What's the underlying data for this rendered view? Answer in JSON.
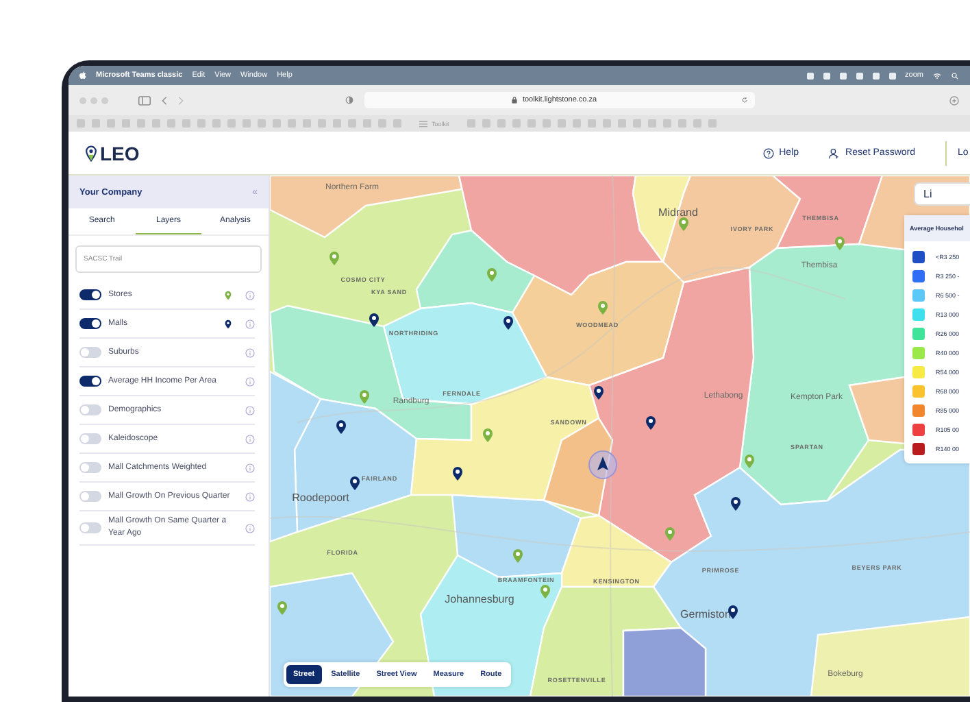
{
  "menu_bar": {
    "app_name": "Microsoft Teams classic",
    "menus": [
      "Edit",
      "View",
      "Window",
      "Help"
    ],
    "status_text": "zoom"
  },
  "browser": {
    "url": "toolkit.lightstone.co.za",
    "bookmark_folder": "Toolkit"
  },
  "header": {
    "logo": "LEO",
    "links": [
      "Help",
      "Reset Password"
    ],
    "cut_link": "Lo"
  },
  "sidebar": {
    "title": "Your Company",
    "collapse": "«",
    "tabs": [
      {
        "label": "Search",
        "selected": false
      },
      {
        "label": "Layers",
        "selected": true
      },
      {
        "label": "Analysis",
        "selected": false
      }
    ],
    "search": {
      "placeholder": "SACSC Trail"
    },
    "layers": [
      {
        "label": "Stores",
        "on": true,
        "color": "#7cb342"
      },
      {
        "label": "Malls",
        "on": true,
        "color": "#0d2a6b"
      },
      {
        "label": "Suburbs",
        "on": false
      },
      {
        "label": "Average HH Income Per Area",
        "on": true
      },
      {
        "label": "Demographics",
        "on": false
      },
      {
        "label": "Kaleidoscope",
        "on": false
      },
      {
        "label": "Mall Catchments Weighted",
        "on": false
      },
      {
        "label": "Mall Growth On Previous Quarter",
        "on": false
      },
      {
        "label": "Mall Growth On Same Quarter a Year Ago",
        "on": false
      }
    ]
  },
  "map": {
    "labels": [
      {
        "text": "Northern Farm",
        "kind": "place"
      },
      {
        "text": "Midrand",
        "kind": "city"
      },
      {
        "text": "THEMBISA",
        "kind": "suburb"
      },
      {
        "text": "IVORY PARK",
        "kind": "suburb"
      },
      {
        "text": "Thembisa",
        "kind": "place"
      },
      {
        "text": "COSMO CITY",
        "kind": "suburb"
      },
      {
        "text": "KYA SAND",
        "kind": "suburb"
      },
      {
        "text": "NORTHRIDING",
        "kind": "suburb"
      },
      {
        "text": "FERNDALE",
        "kind": "suburb"
      },
      {
        "text": "Randburg",
        "kind": "place"
      },
      {
        "text": "WOODMEAD",
        "kind": "suburb"
      },
      {
        "text": "Lethabong",
        "kind": "place"
      },
      {
        "text": "Kempton Park",
        "kind": "place"
      },
      {
        "text": "SPARTAN",
        "kind": "suburb"
      },
      {
        "text": "SANDOWN",
        "kind": "suburb"
      },
      {
        "text": "Roodepoort",
        "kind": "city"
      },
      {
        "text": "FAIRLAND",
        "kind": "suburb"
      },
      {
        "text": "PRIMROSE",
        "kind": "suburb"
      },
      {
        "text": "FLORIDA",
        "kind": "suburb"
      },
      {
        "text": "Johannesburg",
        "kind": "city"
      },
      {
        "text": "Germiston",
        "kind": "city"
      },
      {
        "text": "BEYERS PARK",
        "kind": "suburb"
      },
      {
        "text": "ROSETTENVILLE",
        "kind": "suburb"
      },
      {
        "text": "Bokeburg",
        "kind": "place"
      },
      {
        "text": "BRAAMFONTEIN",
        "kind": "suburb"
      },
      {
        "text": "KENSINGTON",
        "kind": "suburb"
      }
    ],
    "tools": [
      {
        "label": "Street",
        "selected": true
      },
      {
        "label": "Satellite",
        "selected": false
      },
      {
        "label": "Street View",
        "selected": false
      },
      {
        "label": "Measure",
        "selected": false
      },
      {
        "label": "Route",
        "selected": false
      }
    ],
    "corner_button": "Li",
    "legend": {
      "title": "Average Househol",
      "items": [
        {
          "label": "<R3 250",
          "color": "#1f4fc4"
        },
        {
          "label": "R3 250 -",
          "color": "#2f6ef5"
        },
        {
          "label": "R6 500 -",
          "color": "#5cc8f8"
        },
        {
          "label": "R13 000",
          "color": "#3fe0ee"
        },
        {
          "label": "R26 000",
          "color": "#3fe39a"
        },
        {
          "label": "R40 000",
          "color": "#9be84a"
        },
        {
          "label": "R54 000",
          "color": "#f7ea45"
        },
        {
          "label": "R68 000",
          "color": "#fbc22f"
        },
        {
          "label": "R85 000",
          "color": "#f2862e"
        },
        {
          "label": "R105 00",
          "color": "#ee4040"
        },
        {
          "label": "R140 00",
          "color": "#b81c1c"
        }
      ]
    }
  }
}
